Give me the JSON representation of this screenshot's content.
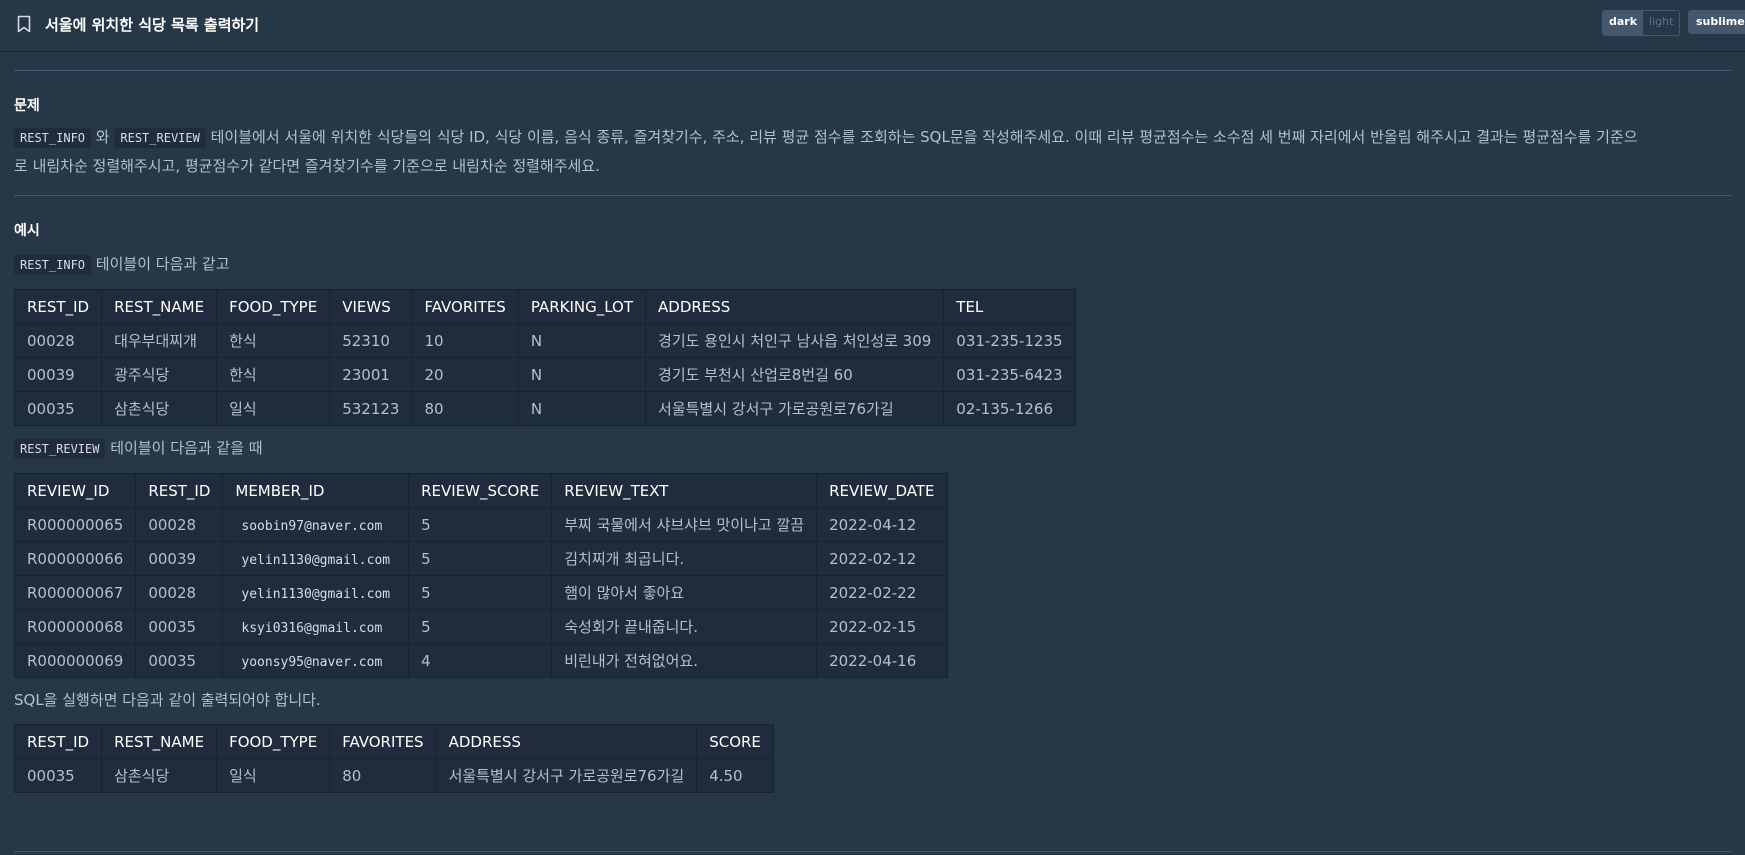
{
  "header": {
    "title": "서울에 위치한 식당 목록 출력하기",
    "theme_toggle": {
      "dark": "dark",
      "light": "light"
    },
    "sublime_label": "sublime"
  },
  "problem": {
    "heading": "문제",
    "code1": "REST_INFO",
    "conj": " 와 ",
    "code2": "REST_REVIEW",
    "text_line1": " 테이블에서 서울에 위치한 식당들의 식당 ID, 식당 이름, 음식 종류, 즐겨찾기수, 주소, 리뷰 평균 점수를 조회하는 SQL문을 작성해주세요. 이때 리뷰 평균점수는 소수점 세 번째 자리에서 반올림 해주시고 결과는 평균점수를 기준으",
    "text_line2": "로 내림차순 정렬해주시고, 평균점수가 같다면 즐겨찾기수를 기준으로 내림차순 정렬해주세요."
  },
  "example": {
    "heading": "예시",
    "info_code": "REST_INFO",
    "info_text": " 테이블이 다음과 같고",
    "review_code": "REST_REVIEW",
    "review_text": " 테이블이 다음과 같을 때",
    "result_text": "SQL을 실행하면 다음과 같이 출력되어야 합니다."
  },
  "rest_info_table": {
    "headers": [
      "REST_ID",
      "REST_NAME",
      "FOOD_TYPE",
      "VIEWS",
      "FAVORITES",
      "PARKING_LOT",
      "ADDRESS",
      "TEL"
    ],
    "rows": [
      [
        "00028",
        "대우부대찌개",
        "한식",
        "52310",
        "10",
        "N",
        "경기도 용인시 처인구 남사읍 처인성로 309",
        "031-235-1235"
      ],
      [
        "00039",
        "광주식당",
        "한식",
        "23001",
        "20",
        "N",
        "경기도 부천시 산업로8번길 60",
        "031-235-6423"
      ],
      [
        "00035",
        "삼촌식당",
        "일식",
        "532123",
        "80",
        "N",
        "서울특별시 강서구 가로공원로76가길",
        "02-135-1266"
      ]
    ]
  },
  "rest_review_table": {
    "headers": [
      "REVIEW_ID",
      "REST_ID",
      "MEMBER_ID",
      "REVIEW_SCORE",
      "REVIEW_TEXT",
      "REVIEW_DATE"
    ],
    "rows": [
      [
        "R000000065",
        "00028",
        "soobin97@naver.com",
        "5",
        "부찌 국물에서 샤브샤브 맛이나고 깔끔",
        "2022-04-12"
      ],
      [
        "R000000066",
        "00039",
        "yelin1130@gmail.com",
        "5",
        "김치찌개 최곱니다.",
        "2022-02-12"
      ],
      [
        "R000000067",
        "00028",
        "yelin1130@gmail.com",
        "5",
        "햄이 많아서 좋아요",
        "2022-02-22"
      ],
      [
        "R000000068",
        "00035",
        "ksyi0316@gmail.com",
        "5",
        "숙성회가 끝내줍니다.",
        "2022-02-15"
      ],
      [
        "R000000069",
        "00035",
        "yoonsy95@naver.com",
        "4",
        "비린내가 전혀없어요.",
        "2022-04-16"
      ]
    ]
  },
  "result_table": {
    "headers": [
      "REST_ID",
      "REST_NAME",
      "FOOD_TYPE",
      "FAVORITES",
      "ADDRESS",
      "SCORE"
    ],
    "rows": [
      [
        "00035",
        "삼촌식당",
        "일식",
        "80",
        "서울특별시 강서구 가로공원로76가길",
        "4.50"
      ]
    ]
  }
}
